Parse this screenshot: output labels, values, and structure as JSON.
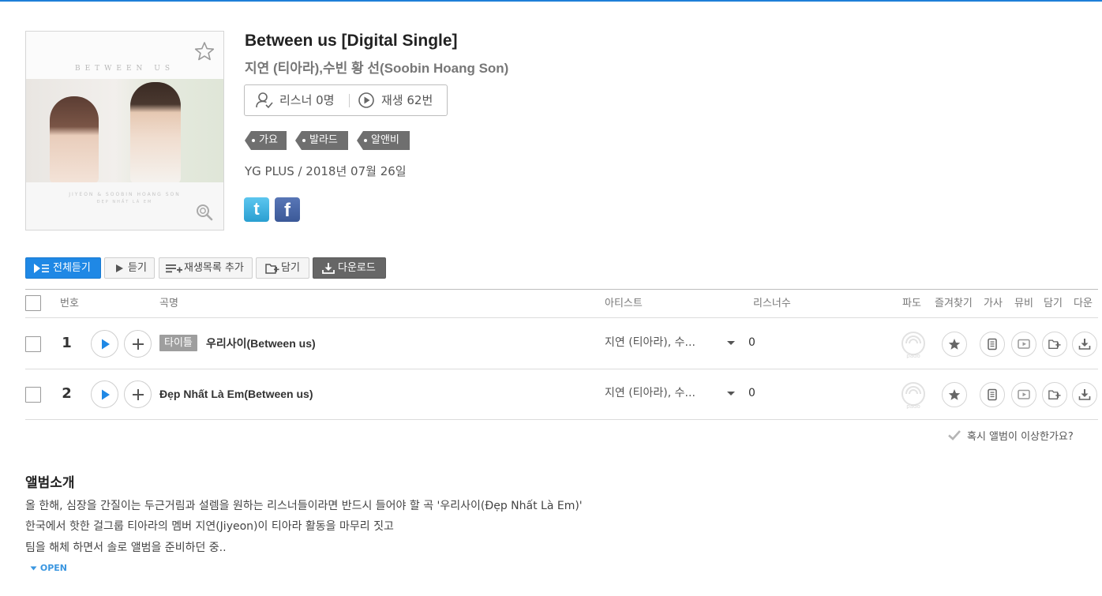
{
  "album": {
    "title": "Between us [Digital Single]",
    "artist": "지연 (티아라),수빈 황 선(Soobin Hoang Son)",
    "cover_title_text": "BETWEEN US",
    "cover_bottom_text1": "JIYEON & SOOBIN HOANG SON",
    "cover_bottom_text2": "ĐẸP NHẤT LÀ EM",
    "listeners": "리스너 0명",
    "plays": "재생 62번",
    "tags": [
      "가요",
      "발라드",
      "알앤비"
    ],
    "meta": "YG PLUS / 2018년 07월 26일"
  },
  "sns": {
    "twitter": "t",
    "facebook": "f"
  },
  "actions": {
    "play_all": "전체듣기",
    "listen": "듣기",
    "add_playlist": "재생목록 추가",
    "save": "담기",
    "download": "다운로드"
  },
  "table": {
    "headers": {
      "number": "번호",
      "title": "곡명",
      "artist": "아티스트",
      "listeners": "리스너수",
      "pado": "파도",
      "favorite": "즐겨찾기",
      "lyrics": "가사",
      "mv": "뮤비",
      "save": "담기",
      "download": "다운"
    },
    "rows": [
      {
        "number": "1",
        "badge": "타이틀",
        "title": "우리사이(Between us)",
        "artist": "지연 (티아라), 수...",
        "listeners": "0"
      },
      {
        "number": "2",
        "badge": "",
        "title": "Đẹp Nhất Là Em(Between us)",
        "artist": "지연 (티아라), 수...",
        "listeners": "0"
      }
    ]
  },
  "report": "혹시 앨범이 이상한가요?",
  "intro": {
    "title": "앨범소개",
    "lines": [
      "올 한해, 심장을 간질이는 두근거림과 설렘을 원하는 리스너들이라면 반드시 들어야 할 곡 '우리사이(Đẹp Nhất Là Em)'",
      "한국에서 핫한 걸그룹 티아라의 멤버 지연(Jiyeon)이 티아라 활동을 마무리 짓고",
      "팀을 해체 하면서 솔로 앨범을 준비하던 중.."
    ],
    "open_label": "OPEN"
  },
  "colors": {
    "accent": "#1f88e5",
    "download_bg": "#666666",
    "tag_bg": "#6f6f6f"
  }
}
